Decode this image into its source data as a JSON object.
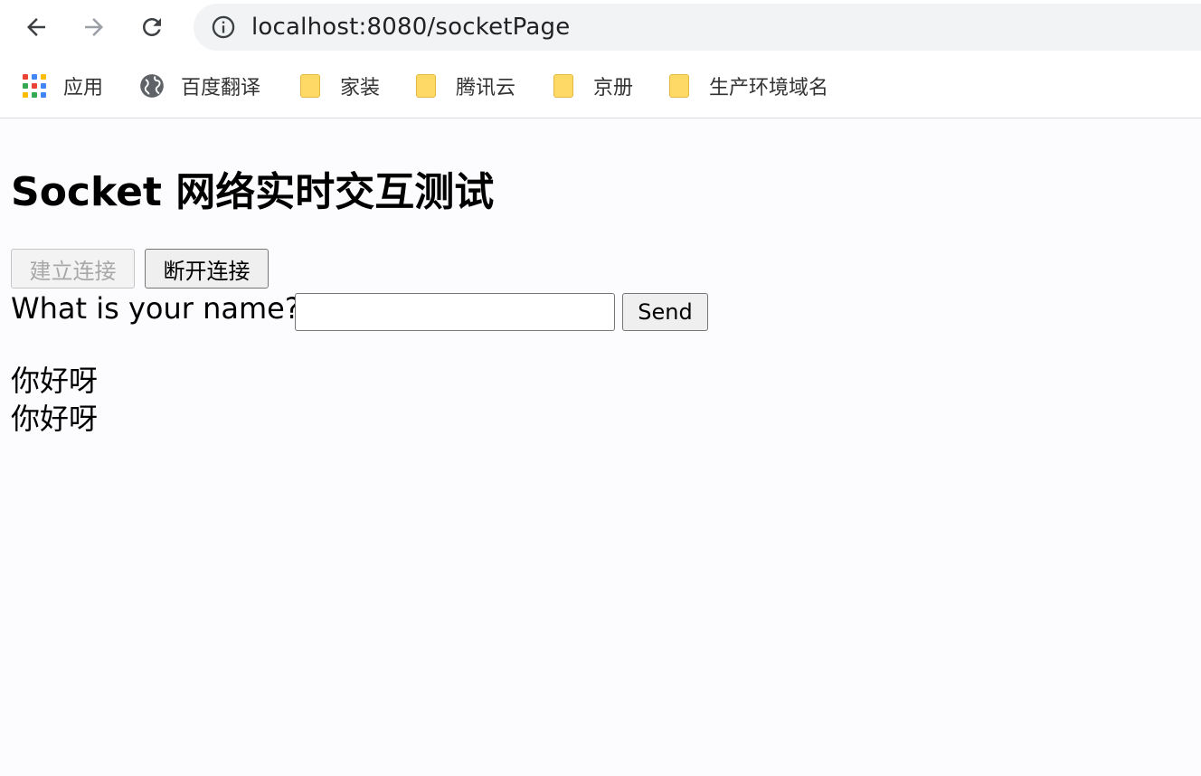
{
  "browser": {
    "url": "localhost:8080/socketPage",
    "bookmarks": [
      {
        "label": "应用",
        "icon": "apps-grid-icon"
      },
      {
        "label": "百度翻译",
        "icon": "globe-icon"
      },
      {
        "label": "家装",
        "icon": "folder-icon"
      },
      {
        "label": "腾讯云",
        "icon": "folder-icon"
      },
      {
        "label": "京册",
        "icon": "folder-icon"
      },
      {
        "label": "生产环境域名",
        "icon": "folder-icon"
      }
    ]
  },
  "page": {
    "title": "Socket 网络实时交互测试",
    "connect_label": "建立连接",
    "connect_disabled": true,
    "disconnect_label": "断开连接",
    "name_prompt": "What is your name?",
    "name_value": "",
    "send_label": "Send",
    "messages": [
      "你好呀",
      "你好呀"
    ]
  }
}
